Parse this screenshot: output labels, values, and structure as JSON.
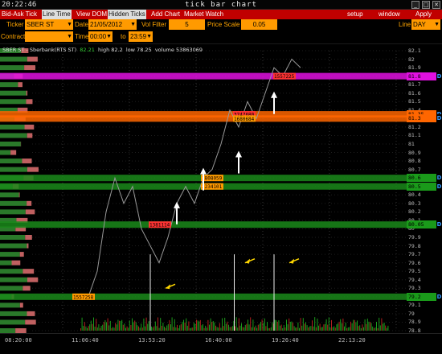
{
  "window": {
    "clock": "20:22:46",
    "title": "tick bar chart",
    "buttons": [
      "_",
      "□",
      "✕"
    ]
  },
  "menu": {
    "left": [
      "Bid-Ask Tick",
      "Line Time",
      "View DOM",
      "Hidden Ticks",
      "Add Chart",
      "Market Watch"
    ],
    "right": [
      "setup",
      "window",
      "Apply"
    ]
  },
  "params": {
    "ticker_label": "Ticker",
    "ticker": "SBER ST",
    "date_label": "Date",
    "date": "21/05/2012",
    "vol_filter_label": "Vol Filter",
    "vol_filter": "5",
    "price_scale_label": "Price Scale",
    "price_scale": "0.05",
    "line_label": "Line",
    "line": "DAY",
    "contract_label": "Contract",
    "contract": "",
    "time_label": "Time",
    "time_from": "00:00",
    "time_to_label": "to",
    "time_to": "23:59"
  },
  "info": {
    "symbol": "SBER ST - Sberbank(RTS ST)",
    "last": "82.21",
    "high": "high 82.2",
    "low": "low 78.25",
    "volume": "volume 53863069"
  },
  "chart_data": {
    "type": "line",
    "title": "",
    "x_ticks": [
      "08:20:00",
      "11:06:40",
      "13:53:20",
      "16:40:00",
      "19:26:40",
      "22:13:20"
    ],
    "y_ticks": [
      "82.1",
      "82",
      "81.9",
      "81.8",
      "81.7",
      "81.6",
      "81.5",
      "81.4",
      "81.3",
      "81.2",
      "81.1",
      "81",
      "80.9",
      "80.8",
      "80.7",
      "80.6",
      "80.5",
      "80.4",
      "80.3",
      "80.2",
      "80.1",
      "80",
      "79.9",
      "79.8",
      "79.7",
      "79.6",
      "79.5",
      "79.4",
      "79.3",
      "79.2",
      "79.1",
      "79",
      "78.9",
      "78.8"
    ],
    "ylim": [
      78.8,
      82.1
    ],
    "price_series": [
      [
        0.2,
        79.2
      ],
      [
        0.22,
        79.5
      ],
      [
        0.24,
        80.2
      ],
      [
        0.26,
        80.6
      ],
      [
        0.28,
        80.3
      ],
      [
        0.3,
        80.5
      ],
      [
        0.32,
        80.0
      ],
      [
        0.34,
        79.8
      ],
      [
        0.36,
        79.6
      ],
      [
        0.38,
        79.9
      ],
      [
        0.4,
        80.3
      ],
      [
        0.42,
        80.5
      ],
      [
        0.44,
        80.3
      ],
      [
        0.46,
        80.6
      ],
      [
        0.48,
        80.7
      ],
      [
        0.5,
        81.0
      ],
      [
        0.52,
        81.4
      ],
      [
        0.54,
        81.2
      ],
      [
        0.56,
        81.5
      ],
      [
        0.58,
        81.3
      ],
      [
        0.6,
        81.6
      ],
      [
        0.62,
        81.9
      ],
      [
        0.64,
        81.8
      ],
      [
        0.66,
        82.0
      ],
      [
        0.68,
        81.9
      ]
    ],
    "levels": [
      {
        "price": 81.8,
        "color": "#e010e0",
        "label": "81.8",
        "volume_label": "1557225",
        "tag_color": "#ff3333"
      },
      {
        "price": 81.35,
        "color": "#ff6600",
        "label": "81.35",
        "volume_label": "3747680",
        "tag_color": "#ff3333"
      },
      {
        "price": 81.3,
        "color": "#ff6600",
        "label": "81.3",
        "volume_label": "1680684",
        "tag_color": "#ff9900"
      },
      {
        "price": 80.6,
        "color": "#1a8a1a",
        "label": "80.6",
        "volume_label": "1808059",
        "tag_color": "#ff9900"
      },
      {
        "price": 80.5,
        "color": "#1a8a1a",
        "label": "80.5",
        "volume_label": "2234101",
        "tag_color": "#ff9900"
      },
      {
        "price": 80.05,
        "color": "#1a8a1a",
        "label": "80.05",
        "volume_label": "1381114",
        "tag_color": "#ff3333"
      },
      {
        "price": 79.2,
        "color": "#1a8a1a",
        "label": "79.2",
        "volume_label": "1557258",
        "tag_color": "#ff9900"
      }
    ],
    "white_arrows": [
      [
        0.62,
        81.6
      ],
      [
        0.54,
        80.9
      ],
      [
        0.46,
        80.7
      ],
      [
        0.4,
        80.3
      ]
    ],
    "yellow_arrows": [
      [
        0.36,
        79.3
      ],
      [
        0.54,
        79.6
      ],
      [
        0.64,
        79.6
      ]
    ],
    "yellow_markers": [
      0.34,
      0.53,
      0.62
    ]
  }
}
